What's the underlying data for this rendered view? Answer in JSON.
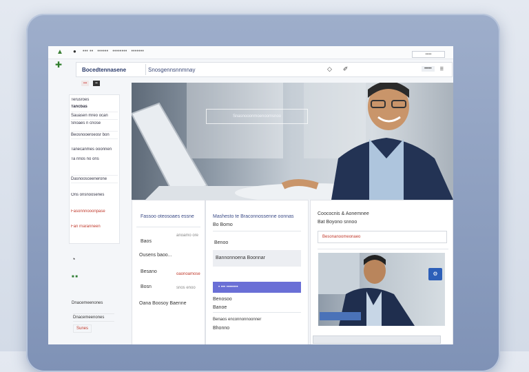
{
  "topbar": {
    "crumbs": [
      "••• ••",
      "••••••",
      "••••••••",
      "•••••••"
    ],
    "button": "•••••"
  },
  "bar2": {
    "title": "Bocedtennasene",
    "subtitle": "Snosgennsnnmnay",
    "right": "•••••"
  },
  "sidebar": {
    "chip1": "•••",
    "chip2": "••",
    "items": [
      "Terusroes",
      "Tancbas",
      "Sauasen mreo ocan",
      "Snoaes n cnose",
      "Beosnooeroeosr bon",
      "Tanecanmes ooonnen",
      "Ta nnos no ons",
      "Dasnoosceenerone",
      "Ons onsnoosenes",
      "Fasonnnooonpase",
      "Fan rnaranneen"
    ],
    "lower": [
      "Dnacemeenones",
      "Sunes"
    ]
  },
  "hero": {
    "caption": "Snasnooonmoenoomsnoo"
  },
  "panel1": {
    "title": "Fassoo oteosoaes essne",
    "rows": [
      "Baos",
      "Ousens baoo...",
      "Besano",
      "Bosn",
      "Oana Boosoy Baenne"
    ],
    "side": [
      "anoamo ore",
      "oaonoamose",
      "snos enoo"
    ]
  },
  "panel2": {
    "title": "Mashesto te Braconnossenne oonnas",
    "rows": [
      "Bo Bomo",
      "Benoo",
      "Bannonnoena Boonnar",
      "Benosoo",
      "Banoe",
      "Benaos enconnonnoonner",
      "Bhonno"
    ],
    "button": "• ••• ••••••••"
  },
  "panel3": {
    "title": "Coococnis & Aonemnee",
    "subtitle": "Bat Boyono snnoo",
    "field": "Besonanoomeonaeo"
  }
}
